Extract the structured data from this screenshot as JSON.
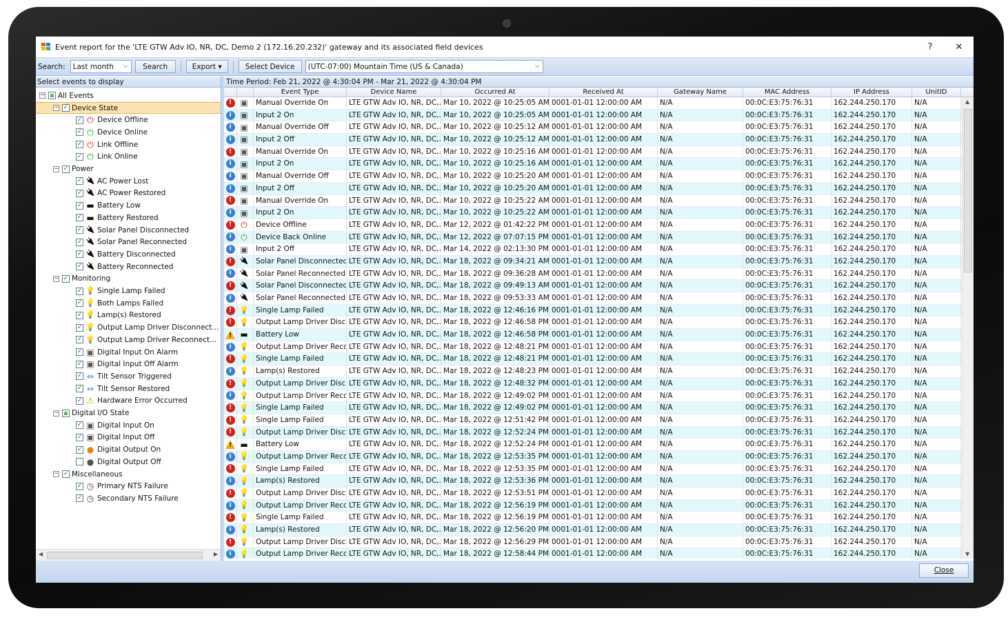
{
  "window": {
    "title": "Event report for the 'LTE GTW Adv IO, NR, DC, Demo 2 (172.16.20.232)' gateway and its associated field devices",
    "help": "?",
    "close": "✕"
  },
  "toolbar": {
    "search_label": "Search:",
    "period_value": "Last month",
    "search_button": "Search",
    "export_button": "Export ▾",
    "select_device_button": "Select Device",
    "timezone_value": "(UTC-07:00) Mountain Time (US & Canada)"
  },
  "left_panel": {
    "header": "Select events to display",
    "tree": [
      {
        "level": 0,
        "label": "All Events",
        "checked": "partial",
        "icon": "",
        "expander": "⊟"
      },
      {
        "level": 1,
        "label": "Device State",
        "checked": true,
        "icon": "",
        "expander": "⊟",
        "selected": true
      },
      {
        "level": 2,
        "label": "Device Offline",
        "checked": true,
        "icon": "power-red"
      },
      {
        "level": 2,
        "label": "Device Online",
        "checked": true,
        "icon": "power-green"
      },
      {
        "level": 2,
        "label": "Link Offline",
        "checked": true,
        "icon": "power-red"
      },
      {
        "level": 2,
        "label": "Link Online",
        "checked": true,
        "icon": "power-green"
      },
      {
        "level": 1,
        "label": "Power",
        "checked": true,
        "icon": "",
        "expander": "⊟"
      },
      {
        "level": 2,
        "label": "AC Power Lost",
        "checked": true,
        "icon": "plug"
      },
      {
        "level": 2,
        "label": "AC Power Restored",
        "checked": true,
        "icon": "plug"
      },
      {
        "level": 2,
        "label": "Battery Low",
        "checked": true,
        "icon": "battery"
      },
      {
        "level": 2,
        "label": "Battery Restored",
        "checked": true,
        "icon": "battery"
      },
      {
        "level": 2,
        "label": "Solar Panel Disconnected",
        "checked": true,
        "icon": "plug"
      },
      {
        "level": 2,
        "label": "Solar Panel Reconnected",
        "checked": true,
        "icon": "plug"
      },
      {
        "level": 2,
        "label": "Battery Disconnected",
        "checked": true,
        "icon": "plug"
      },
      {
        "level": 2,
        "label": "Battery Reconnected",
        "checked": true,
        "icon": "plug"
      },
      {
        "level": 1,
        "label": "Monitoring",
        "checked": true,
        "icon": "",
        "expander": "⊟"
      },
      {
        "level": 2,
        "label": "Single Lamp Failed",
        "checked": true,
        "icon": "lamp"
      },
      {
        "level": 2,
        "label": "Both Lamps Failed",
        "checked": true,
        "icon": "lamp"
      },
      {
        "level": 2,
        "label": "Lamp(s) Restored",
        "checked": true,
        "icon": "lamp"
      },
      {
        "level": 2,
        "label": "Output Lamp Driver Disconnect...",
        "checked": true,
        "icon": "lamp"
      },
      {
        "level": 2,
        "label": "Output Lamp Driver Reconnect...",
        "checked": true,
        "icon": "lamp"
      },
      {
        "level": 2,
        "label": "Digital Input On Alarm",
        "checked": true,
        "icon": "io"
      },
      {
        "level": 2,
        "label": "Digital Input Off Alarm",
        "checked": true,
        "icon": "io"
      },
      {
        "level": 2,
        "label": "Tilt Sensor Triggered",
        "checked": true,
        "icon": "tilt"
      },
      {
        "level": 2,
        "label": "Tilt Sensor Restored",
        "checked": true,
        "icon": "tilt"
      },
      {
        "level": 2,
        "label": "Hardware Error Occurred",
        "checked": true,
        "icon": "warn"
      },
      {
        "level": 1,
        "label": "Digital I/O State",
        "checked": "partial",
        "icon": "",
        "expander": "⊟"
      },
      {
        "level": 2,
        "label": "Digital Input On",
        "checked": true,
        "icon": "io"
      },
      {
        "level": 2,
        "label": "Digital Input Off",
        "checked": true,
        "icon": "io"
      },
      {
        "level": 2,
        "label": "Digital Output On",
        "checked": true,
        "icon": "dot-orange"
      },
      {
        "level": 2,
        "label": "Digital Output Off",
        "checked": false,
        "icon": "dot-gray"
      },
      {
        "level": 1,
        "label": "Miscellaneous",
        "checked": true,
        "icon": "",
        "expander": "⊟"
      },
      {
        "level": 2,
        "label": "Primary NTS Failure",
        "checked": true,
        "icon": "clock"
      },
      {
        "level": 2,
        "label": "Secondary NTS Failure",
        "checked": true,
        "icon": "clock"
      }
    ]
  },
  "grid": {
    "period": "Time Period: Feb 21, 2022 @ 4:30:04 PM  -  Mar 21, 2022 @ 4:30:04 PM",
    "columns": [
      "",
      "",
      "Event Type",
      "Device Name",
      "Occurred At",
      "Received At",
      "Gateway Name",
      "MAC Address",
      "IP Address",
      "UnitID"
    ],
    "rows": [
      {
        "sev": "err",
        "icon": "io",
        "type": "Manual Override On",
        "device": "LTE GTW Adv IO, NR, DC,...",
        "occurred": "Mar 10, 2022 @ 10:25:05 AM",
        "received": "0001-01-01 12:00:00 AM",
        "gateway": "N/A",
        "mac": "00:0C:E3:75:76:31",
        "ip": "162.244.250.170",
        "unit": "N/A"
      },
      {
        "sev": "info",
        "icon": "io",
        "type": "Input 2 On",
        "device": "LTE GTW Adv IO, NR, DC,...",
        "occurred": "Mar 10, 2022 @ 10:25:05 AM",
        "received": "0001-01-01 12:00:00 AM",
        "gateway": "N/A",
        "mac": "00:0C:E3:75:76:31",
        "ip": "162.244.250.170",
        "unit": "N/A"
      },
      {
        "sev": "info",
        "icon": "io",
        "type": "Manual Override Off",
        "device": "LTE GTW Adv IO, NR, DC,...",
        "occurred": "Mar 10, 2022 @ 10:25:12 AM",
        "received": "0001-01-01 12:00:00 AM",
        "gateway": "N/A",
        "mac": "00:0C:E3:75:76:31",
        "ip": "162.244.250.170",
        "unit": "N/A"
      },
      {
        "sev": "info",
        "icon": "io",
        "type": "Input 2 Off",
        "device": "LTE GTW Adv IO, NR, DC,...",
        "occurred": "Mar 10, 2022 @ 10:25:12 AM",
        "received": "0001-01-01 12:00:00 AM",
        "gateway": "N/A",
        "mac": "00:0C:E3:75:76:31",
        "ip": "162.244.250.170",
        "unit": "N/A"
      },
      {
        "sev": "err",
        "icon": "io",
        "type": "Manual Override On",
        "device": "LTE GTW Adv IO, NR, DC,...",
        "occurred": "Mar 10, 2022 @ 10:25:16 AM",
        "received": "0001-01-01 12:00:00 AM",
        "gateway": "N/A",
        "mac": "00:0C:E3:75:76:31",
        "ip": "162.244.250.170",
        "unit": "N/A"
      },
      {
        "sev": "info",
        "icon": "io",
        "type": "Input 2 On",
        "device": "LTE GTW Adv IO, NR, DC,...",
        "occurred": "Mar 10, 2022 @ 10:25:16 AM",
        "received": "0001-01-01 12:00:00 AM",
        "gateway": "N/A",
        "mac": "00:0C:E3:75:76:31",
        "ip": "162.244.250.170",
        "unit": "N/A"
      },
      {
        "sev": "info",
        "icon": "io",
        "type": "Manual Override Off",
        "device": "LTE GTW Adv IO, NR, DC,...",
        "occurred": "Mar 10, 2022 @ 10:25:20 AM",
        "received": "0001-01-01 12:00:00 AM",
        "gateway": "N/A",
        "mac": "00:0C:E3:75:76:31",
        "ip": "162.244.250.170",
        "unit": "N/A"
      },
      {
        "sev": "info",
        "icon": "io",
        "type": "Input 2 Off",
        "device": "LTE GTW Adv IO, NR, DC,...",
        "occurred": "Mar 10, 2022 @ 10:25:20 AM",
        "received": "0001-01-01 12:00:00 AM",
        "gateway": "N/A",
        "mac": "00:0C:E3:75:76:31",
        "ip": "162.244.250.170",
        "unit": "N/A"
      },
      {
        "sev": "err",
        "icon": "io",
        "type": "Manual Override On",
        "device": "LTE GTW Adv IO, NR, DC,...",
        "occurred": "Mar 10, 2022 @ 10:25:22 AM",
        "received": "0001-01-01 12:00:00 AM",
        "gateway": "N/A",
        "mac": "00:0C:E3:75:76:31",
        "ip": "162.244.250.170",
        "unit": "N/A"
      },
      {
        "sev": "info",
        "icon": "io",
        "type": "Input 2 On",
        "device": "LTE GTW Adv IO, NR, DC,...",
        "occurred": "Mar 10, 2022 @ 10:25:22 AM",
        "received": "0001-01-01 12:00:00 AM",
        "gateway": "N/A",
        "mac": "00:0C:E3:75:76:31",
        "ip": "162.244.250.170",
        "unit": "N/A"
      },
      {
        "sev": "err",
        "icon": "power-red",
        "type": "Device Offline",
        "device": "LTE GTW Adv IO, NR, DC,...",
        "occurred": "Mar 12, 2022 @ 01:42:22 PM",
        "received": "0001-01-01 12:00:00 AM",
        "gateway": "N/A",
        "mac": "00:0C:E3:75:76:31",
        "ip": "162.244.250.170",
        "unit": "N/A"
      },
      {
        "sev": "info",
        "icon": "power-green",
        "type": "Device Back Online",
        "device": "LTE GTW Adv IO, NR, DC,...",
        "occurred": "Mar 12, 2022 @ 07:07:15 PM",
        "received": "0001-01-01 12:00:00 AM",
        "gateway": "N/A",
        "mac": "00:0C:E3:75:76:31",
        "ip": "162.244.250.170",
        "unit": "N/A"
      },
      {
        "sev": "info",
        "icon": "io",
        "type": "Input 2 Off",
        "device": "LTE GTW Adv IO, NR, DC,...",
        "occurred": "Mar 14, 2022 @ 02:13:30 PM",
        "received": "0001-01-01 12:00:00 AM",
        "gateway": "N/A",
        "mac": "00:0C:E3:75:76:31",
        "ip": "162.244.250.170",
        "unit": "N/A"
      },
      {
        "sev": "err",
        "icon": "plug",
        "type": "Solar Panel Disconnected",
        "device": "LTE GTW Adv IO, NR, DC,...",
        "occurred": "Mar 18, 2022 @ 09:34:21 AM",
        "received": "0001-01-01 12:00:00 AM",
        "gateway": "N/A",
        "mac": "00:0C:E3:75:76:31",
        "ip": "162.244.250.170",
        "unit": "N/A"
      },
      {
        "sev": "info",
        "icon": "plug",
        "type": "Solar Panel Reconnected",
        "device": "LTE GTW Adv IO, NR, DC,...",
        "occurred": "Mar 18, 2022 @ 09:36:28 AM",
        "received": "0001-01-01 12:00:00 AM",
        "gateway": "N/A",
        "mac": "00:0C:E3:75:76:31",
        "ip": "162.244.250.170",
        "unit": "N/A"
      },
      {
        "sev": "err",
        "icon": "plug",
        "type": "Solar Panel Disconnected",
        "device": "LTE GTW Adv IO, NR, DC,...",
        "occurred": "Mar 18, 2022 @ 09:49:13 AM",
        "received": "0001-01-01 12:00:00 AM",
        "gateway": "N/A",
        "mac": "00:0C:E3:75:76:31",
        "ip": "162.244.250.170",
        "unit": "N/A"
      },
      {
        "sev": "info",
        "icon": "plug",
        "type": "Solar Panel Reconnected",
        "device": "LTE GTW Adv IO, NR, DC,...",
        "occurred": "Mar 18, 2022 @ 09:53:33 AM",
        "received": "0001-01-01 12:00:00 AM",
        "gateway": "N/A",
        "mac": "00:0C:E3:75:76:31",
        "ip": "162.244.250.170",
        "unit": "N/A"
      },
      {
        "sev": "err",
        "icon": "lamp",
        "type": "Single Lamp Failed",
        "device": "LTE GTW Adv IO, NR, DC,...",
        "occurred": "Mar 18, 2022 @ 12:46:16 PM",
        "received": "0001-01-01 12:00:00 AM",
        "gateway": "N/A",
        "mac": "00:0C:E3:75:76:31",
        "ip": "162.244.250.170",
        "unit": "N/A"
      },
      {
        "sev": "err",
        "icon": "lamp",
        "type": "Output Lamp Driver Disc...",
        "device": "LTE GTW Adv IO, NR, DC,...",
        "occurred": "Mar 18, 2022 @ 12:46:58 PM",
        "received": "0001-01-01 12:00:00 AM",
        "gateway": "N/A",
        "mac": "00:0C:E3:75:76:31",
        "ip": "162.244.250.170",
        "unit": "N/A"
      },
      {
        "sev": "warn",
        "icon": "battery",
        "type": "Battery Low",
        "device": "LTE GTW Adv IO, NR, DC,...",
        "occurred": "Mar 18, 2022 @ 12:46:58 PM",
        "received": "0001-01-01 12:00:00 AM",
        "gateway": "N/A",
        "mac": "00:0C:E3:75:76:31",
        "ip": "162.244.250.170",
        "unit": "N/A"
      },
      {
        "sev": "info",
        "icon": "lamp",
        "type": "Output Lamp Driver Reco...",
        "device": "LTE GTW Adv IO, NR, DC,...",
        "occurred": "Mar 18, 2022 @ 12:48:21 PM",
        "received": "0001-01-01 12:00:00 AM",
        "gateway": "N/A",
        "mac": "00:0C:E3:75:76:31",
        "ip": "162.244.250.170",
        "unit": "N/A"
      },
      {
        "sev": "err",
        "icon": "lamp",
        "type": "Single Lamp Failed",
        "device": "LTE GTW Adv IO, NR, DC,...",
        "occurred": "Mar 18, 2022 @ 12:48:21 PM",
        "received": "0001-01-01 12:00:00 AM",
        "gateway": "N/A",
        "mac": "00:0C:E3:75:76:31",
        "ip": "162.244.250.170",
        "unit": "N/A"
      },
      {
        "sev": "info",
        "icon": "lamp",
        "type": "Lamp(s) Restored",
        "device": "LTE GTW Adv IO, NR, DC,...",
        "occurred": "Mar 18, 2022 @ 12:48:23 PM",
        "received": "0001-01-01 12:00:00 AM",
        "gateway": "N/A",
        "mac": "00:0C:E3:75:76:31",
        "ip": "162.244.250.170",
        "unit": "N/A"
      },
      {
        "sev": "err",
        "icon": "lamp",
        "type": "Output Lamp Driver Disc...",
        "device": "LTE GTW Adv IO, NR, DC,...",
        "occurred": "Mar 18, 2022 @ 12:48:32 PM",
        "received": "0001-01-01 12:00:00 AM",
        "gateway": "N/A",
        "mac": "00:0C:E3:75:76:31",
        "ip": "162.244.250.170",
        "unit": "N/A"
      },
      {
        "sev": "info",
        "icon": "lamp",
        "type": "Output Lamp Driver Reco...",
        "device": "LTE GTW Adv IO, NR, DC,...",
        "occurred": "Mar 18, 2022 @ 12:49:02 PM",
        "received": "0001-01-01 12:00:00 AM",
        "gateway": "N/A",
        "mac": "00:0C:E3:75:76:31",
        "ip": "162.244.250.170",
        "unit": "N/A"
      },
      {
        "sev": "err",
        "icon": "lamp",
        "type": "Single Lamp Failed",
        "device": "LTE GTW Adv IO, NR, DC,...",
        "occurred": "Mar 18, 2022 @ 12:49:02 PM",
        "received": "0001-01-01 12:00:00 AM",
        "gateway": "N/A",
        "mac": "00:0C:E3:75:76:31",
        "ip": "162.244.250.170",
        "unit": "N/A"
      },
      {
        "sev": "err",
        "icon": "lamp",
        "type": "Single Lamp Failed",
        "device": "LTE GTW Adv IO, NR, DC,...",
        "occurred": "Mar 18, 2022 @ 12:51:42 PM",
        "received": "0001-01-01 12:00:00 AM",
        "gateway": "N/A",
        "mac": "00:0C:E3:75:76:31",
        "ip": "162.244.250.170",
        "unit": "N/A"
      },
      {
        "sev": "err",
        "icon": "lamp",
        "type": "Output Lamp Driver Disc...",
        "device": "LTE GTW Adv IO, NR, DC,...",
        "occurred": "Mar 18, 2022 @ 12:52:24 PM",
        "received": "0001-01-01 12:00:00 AM",
        "gateway": "N/A",
        "mac": "00:0C:E3:75:76:31",
        "ip": "162.244.250.170",
        "unit": "N/A"
      },
      {
        "sev": "warn",
        "icon": "battery",
        "type": "Battery Low",
        "device": "LTE GTW Adv IO, NR, DC,...",
        "occurred": "Mar 18, 2022 @ 12:52:24 PM",
        "received": "0001-01-01 12:00:00 AM",
        "gateway": "N/A",
        "mac": "00:0C:E3:75:76:31",
        "ip": "162.244.250.170",
        "unit": "N/A"
      },
      {
        "sev": "info",
        "icon": "lamp",
        "type": "Output Lamp Driver Reco...",
        "device": "LTE GTW Adv IO, NR, DC,...",
        "occurred": "Mar 18, 2022 @ 12:53:35 PM",
        "received": "0001-01-01 12:00:00 AM",
        "gateway": "N/A",
        "mac": "00:0C:E3:75:76:31",
        "ip": "162.244.250.170",
        "unit": "N/A"
      },
      {
        "sev": "err",
        "icon": "lamp",
        "type": "Single Lamp Failed",
        "device": "LTE GTW Adv IO, NR, DC,...",
        "occurred": "Mar 18, 2022 @ 12:53:35 PM",
        "received": "0001-01-01 12:00:00 AM",
        "gateway": "N/A",
        "mac": "00:0C:E3:75:76:31",
        "ip": "162.244.250.170",
        "unit": "N/A"
      },
      {
        "sev": "info",
        "icon": "lamp",
        "type": "Lamp(s) Restored",
        "device": "LTE GTW Adv IO, NR, DC,...",
        "occurred": "Mar 18, 2022 @ 12:53:36 PM",
        "received": "0001-01-01 12:00:00 AM",
        "gateway": "N/A",
        "mac": "00:0C:E3:75:76:31",
        "ip": "162.244.250.170",
        "unit": "N/A"
      },
      {
        "sev": "err",
        "icon": "lamp",
        "type": "Output Lamp Driver Disc...",
        "device": "LTE GTW Adv IO, NR, DC,...",
        "occurred": "Mar 18, 2022 @ 12:53:51 PM",
        "received": "0001-01-01 12:00:00 AM",
        "gateway": "N/A",
        "mac": "00:0C:E3:75:76:31",
        "ip": "162.244.250.170",
        "unit": "N/A"
      },
      {
        "sev": "info",
        "icon": "lamp",
        "type": "Output Lamp Driver Reco...",
        "device": "LTE GTW Adv IO, NR, DC,...",
        "occurred": "Mar 18, 2022 @ 12:56:19 PM",
        "received": "0001-01-01 12:00:00 AM",
        "gateway": "N/A",
        "mac": "00:0C:E3:75:76:31",
        "ip": "162.244.250.170",
        "unit": "N/A"
      },
      {
        "sev": "err",
        "icon": "lamp",
        "type": "Single Lamp Failed",
        "device": "LTE GTW Adv IO, NR, DC,...",
        "occurred": "Mar 18, 2022 @ 12:56:19 PM",
        "received": "0001-01-01 12:00:00 AM",
        "gateway": "N/A",
        "mac": "00:0C:E3:75:76:31",
        "ip": "162.244.250.170",
        "unit": "N/A"
      },
      {
        "sev": "info",
        "icon": "lamp",
        "type": "Lamp(s) Restored",
        "device": "LTE GTW Adv IO, NR, DC,...",
        "occurred": "Mar 18, 2022 @ 12:56:20 PM",
        "received": "0001-01-01 12:00:00 AM",
        "gateway": "N/A",
        "mac": "00:0C:E3:75:76:31",
        "ip": "162.244.250.170",
        "unit": "N/A"
      },
      {
        "sev": "err",
        "icon": "lamp",
        "type": "Output Lamp Driver Disc...",
        "device": "LTE GTW Adv IO, NR, DC,...",
        "occurred": "Mar 18, 2022 @ 12:56:29 PM",
        "received": "0001-01-01 12:00:00 AM",
        "gateway": "N/A",
        "mac": "00:0C:E3:75:76:31",
        "ip": "162.244.250.170",
        "unit": "N/A"
      },
      {
        "sev": "info",
        "icon": "lamp",
        "type": "Output Lamp Driver Reco...",
        "device": "LTE GTW Adv IO, NR, DC,...",
        "occurred": "Mar 18, 2022 @ 12:58:44 PM",
        "received": "0001-01-01 12:00:00 AM",
        "gateway": "N/A",
        "mac": "00:0C:E3:75:76:31",
        "ip": "162.244.250.170",
        "unit": "N/A"
      }
    ]
  },
  "footer": {
    "close_button": "Close"
  },
  "colors": {
    "error": "#d0231b",
    "info": "#3b7fd4",
    "warning": "#f0b400",
    "row_alt": "#e2f8fb",
    "selection": "#fbe2b3",
    "toolbar": "#c8daf1"
  }
}
